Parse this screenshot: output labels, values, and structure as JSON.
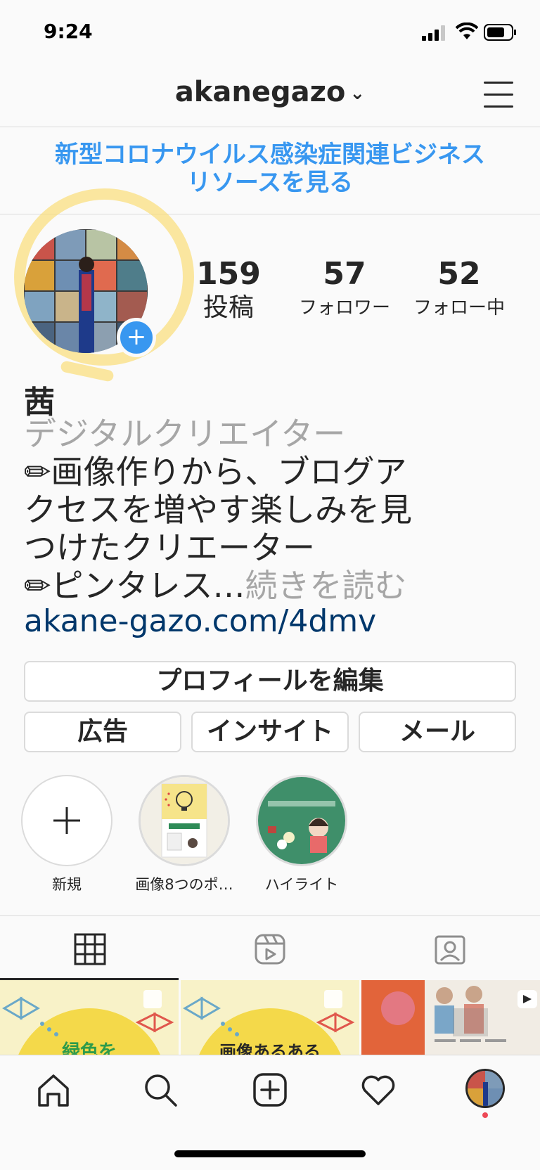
{
  "status_bar": {
    "time": "9:24"
  },
  "header": {
    "username": "akanegazo",
    "chevron": "⌄"
  },
  "banner": {
    "line1": "新型コロナウイルス感染症関連ビジネス",
    "line2": "リソースを見る"
  },
  "stats": [
    {
      "value": "159",
      "label": "投稿"
    },
    {
      "value": "57",
      "label": "フォロワー"
    },
    {
      "value": "52",
      "label": "フォロー中"
    }
  ],
  "profile": {
    "name": "茜",
    "category": "デジタルクリエイター",
    "bio_line1": "✏画像作りから、ブログア",
    "bio_line2": "クセスを増やす楽しみを見",
    "bio_line3": "つけたクリエーター",
    "bio_line4": "✏ピンタレス…",
    "read_more": "続きを読む",
    "link": "akane-gazo.com/4dmv"
  },
  "buttons": {
    "edit_profile": "プロフィールを編集",
    "ads": "広告",
    "insights": "インサイト",
    "email": "メール"
  },
  "highlights": [
    {
      "label": "新規",
      "icon": "plus-icon"
    },
    {
      "label": "画像8つのポ…"
    },
    {
      "label": "ハイライト"
    }
  ],
  "grid": {
    "thumb1_text": "緑色を",
    "thumb2_text": "画像あるある"
  },
  "tabs": [
    "grid-icon",
    "reels-icon",
    "tagged-icon"
  ],
  "nav": [
    "home-icon",
    "search-icon",
    "new-post-icon",
    "heart-icon",
    "profile-avatar"
  ],
  "colors": {
    "accent": "#3897f0",
    "link": "#00376b",
    "border": "#dbdbdb",
    "muted": "#a6a6a6"
  }
}
